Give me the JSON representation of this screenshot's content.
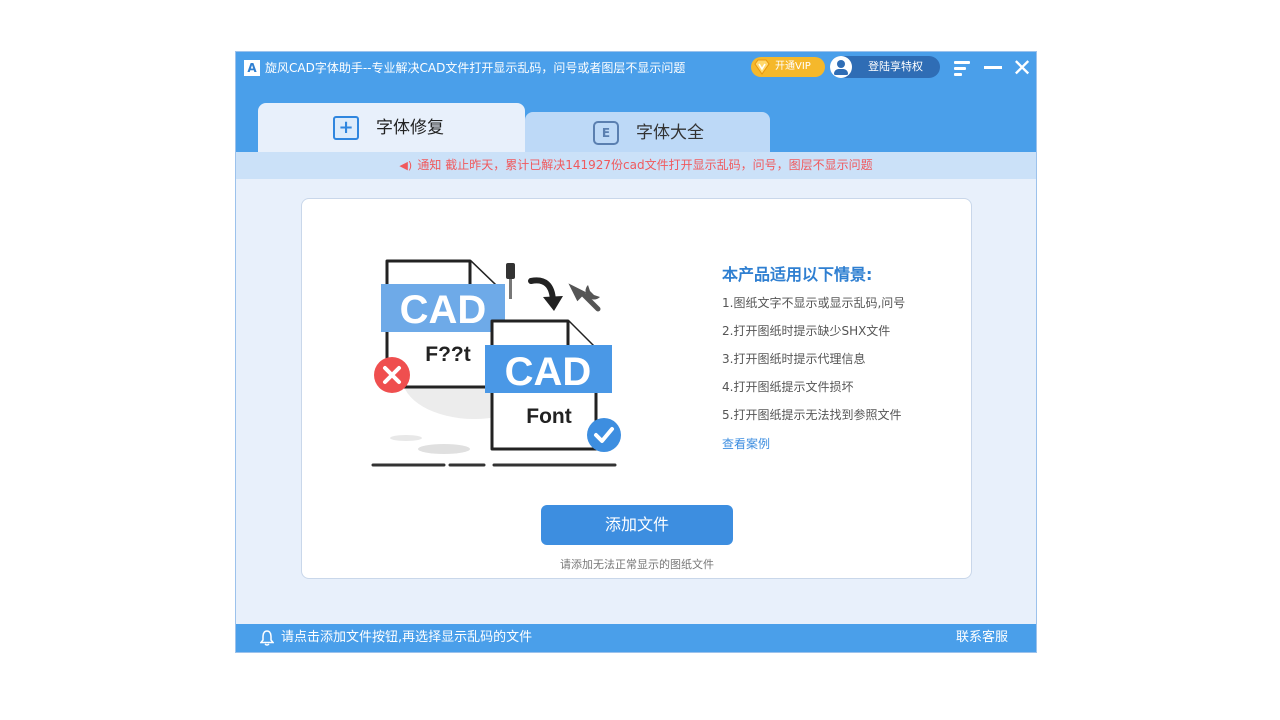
{
  "window": {
    "title": "旋风CAD字体助手--专业解决CAD文件打开显示乱码，问号或者图层不显示问题",
    "logo": "A",
    "vip_label": "开通VIP",
    "login_label": "登陆享特权",
    "close_glyph": "✕"
  },
  "tabs": [
    {
      "label": "字体修复",
      "icon": "medkit-icon",
      "active": true
    },
    {
      "label": "字体大全",
      "icon": "font-book-icon",
      "active": false
    }
  ],
  "tab_icon_text": {
    "repair": "+",
    "library": "E"
  },
  "notice": {
    "icon": "speaker-icon",
    "text": "通知 截止昨天，累计已解决141927份cad文件打开显示乱码，问号，图层不显示问题"
  },
  "illustration": {
    "broken_label": "CAD",
    "broken_text": "F??t",
    "fixed_label": "CAD",
    "fixed_text": "Font"
  },
  "scenarios": {
    "title": "本产品适用以下情景:",
    "items": [
      "1.图纸文字不显示或显示乱码,问号",
      "2.打开图纸时提示缺少SHX文件",
      "3.打开图纸时提示代理信息",
      "4.打开图纸提示文件损坏",
      "5.打开图纸提示无法找到参照文件"
    ],
    "link": "查看案例"
  },
  "add_button": {
    "label": "添加文件",
    "hint": "请添加无法正常显示的图纸文件"
  },
  "footer": {
    "hint": "请点击添加文件按钮,再选择显示乱码的文件",
    "support": "联系客服"
  },
  "colors": {
    "primary": "#4a9fea",
    "accent": "#3d8ee0",
    "notice_text": "#f0595d",
    "vip": "#f5b82b",
    "error": "#ef4f4f"
  }
}
